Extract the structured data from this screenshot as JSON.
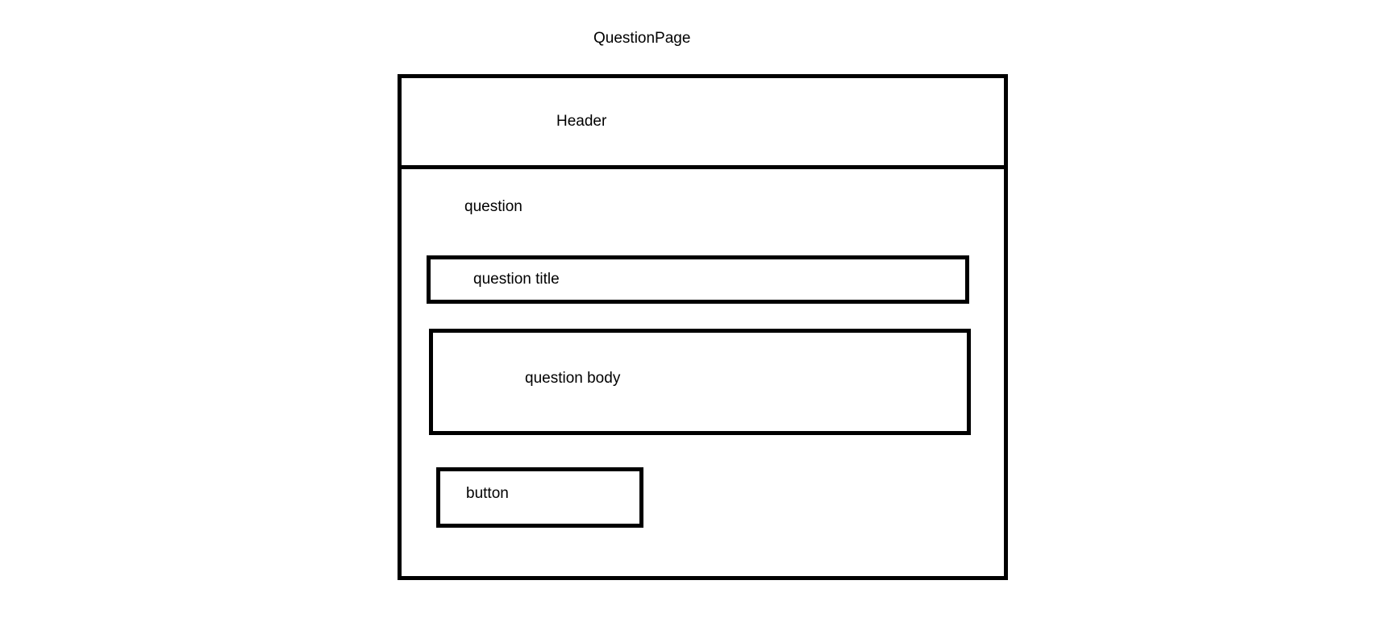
{
  "page": {
    "title": "QuestionPage"
  },
  "frame": {
    "header_label": "Header",
    "question_label": "question"
  },
  "question_title_box": {
    "label": "question title"
  },
  "question_body_box": {
    "label": "question body"
  },
  "button_box": {
    "label": "button"
  },
  "colors": {
    "stroke": "#000000",
    "background": "#ffffff"
  }
}
